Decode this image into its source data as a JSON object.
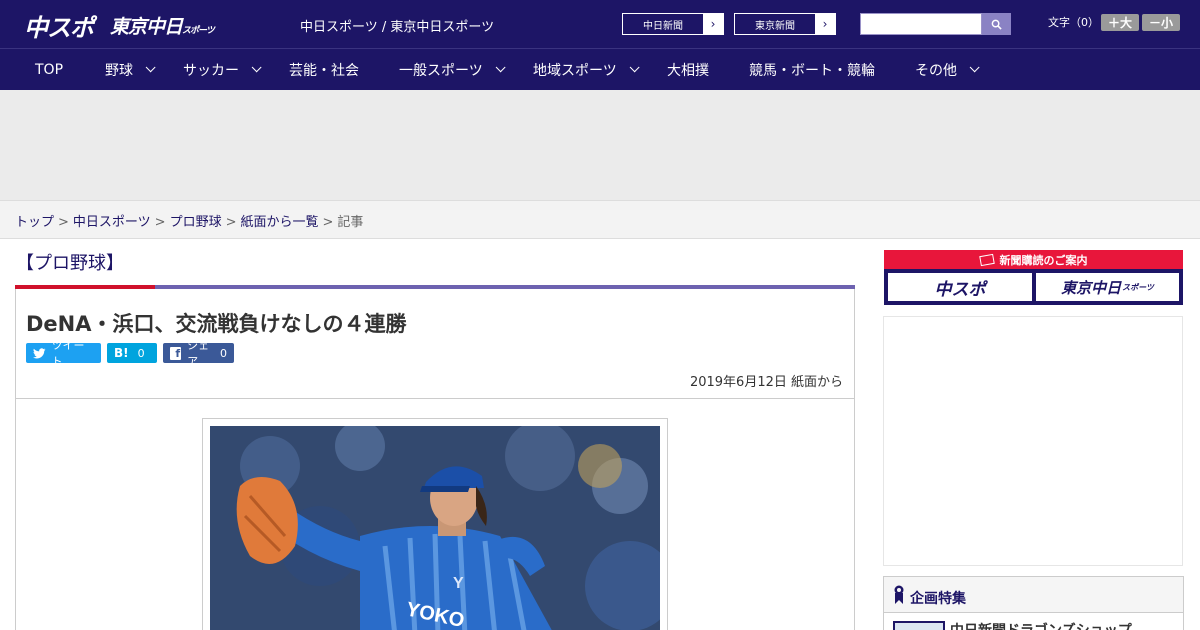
{
  "header": {
    "logo_chuspo": "中スポ",
    "logo_tokyo": "東京中日",
    "logo_tokyo_small": "スポーツ",
    "site_title": "中日スポーツ / 東京中日スポーツ",
    "paper_links": [
      {
        "label": "中日新聞"
      },
      {
        "label": "東京新聞"
      }
    ],
    "search": {
      "value": "",
      "placeholder": "",
      "icon": "search-icon"
    },
    "font_size": {
      "label": "文字（0）",
      "larger": "＋大",
      "smaller": "－小"
    }
  },
  "nav": {
    "items": [
      {
        "label": "TOP",
        "dropdown": false
      },
      {
        "label": "野球",
        "dropdown": true
      },
      {
        "label": "サッカー",
        "dropdown": true
      },
      {
        "label": "芸能・社会",
        "dropdown": false
      },
      {
        "label": "一般スポーツ",
        "dropdown": true
      },
      {
        "label": "地域スポーツ",
        "dropdown": true
      },
      {
        "label": "大相撲",
        "dropdown": false
      },
      {
        "label": "競馬・ボート・競輪",
        "dropdown": false
      },
      {
        "label": "その他",
        "dropdown": true
      }
    ]
  },
  "breadcrumb": {
    "items": [
      "トップ",
      "中日スポーツ",
      "プロ野球",
      "紙面から一覧"
    ],
    "current": "記事",
    "separator": ">"
  },
  "article": {
    "category": "【プロ野球】",
    "headline": "DeNA・浜口、交流戦負けなしの４連勝",
    "share": {
      "tweet_label": "ツイート",
      "hatena_label": "B!",
      "hatena_count": "0",
      "facebook_label": "シェア",
      "facebook_count": "0"
    },
    "date": "2019年6月12日 紙面から"
  },
  "sidebar": {
    "subscribe_banner": {
      "title": "新聞購読のご案内",
      "left": "中スポ",
      "right": "東京中日",
      "right_small": "スポーツ"
    },
    "feature": {
      "title": "企画特集",
      "first_item": "中日新聞ドラゴンズショップ"
    }
  },
  "colors": {
    "brand_navy": "#1d1566",
    "accent_red": "#d0112b",
    "accent_purple": "#6d62b0",
    "twitter": "#1da1f2",
    "hatena": "#00a4de",
    "facebook": "#3b5998"
  }
}
